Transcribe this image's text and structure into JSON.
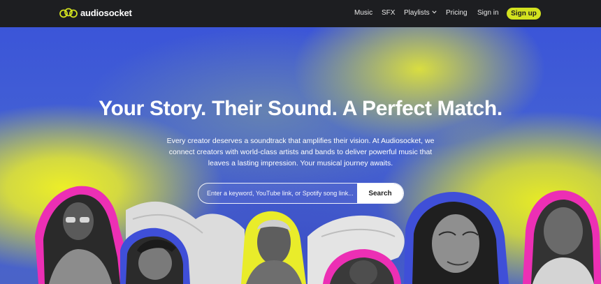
{
  "brand": {
    "name": "audiosocket"
  },
  "nav": {
    "items": [
      {
        "label": "Music"
      },
      {
        "label": "SFX"
      },
      {
        "label": "Playlists"
      },
      {
        "label": "Pricing"
      },
      {
        "label": "Sign in"
      }
    ],
    "signup_label": "Sign up"
  },
  "hero": {
    "title": "Your Story. Their Sound. A Perfect Match.",
    "subtitle": "Every creator deserves a soundtrack that amplifies their vision. At Audiosocket, we connect creators with world-class artists and bands to deliver powerful music that leaves a lasting impression. Your musical journey awaits.",
    "search": {
      "placeholder": "Enter a keyword, YouTube link, or Spotify song link...",
      "value": "",
      "button_label": "Search"
    }
  },
  "colors": {
    "navbar_bg": "#1d1e21",
    "accent_lime": "#d3e21f",
    "hero_blue": "#3b55d8",
    "hero_yellow": "#ecee28",
    "sticker_pink": "#ec2fb4",
    "sticker_blue": "#3f4fd8"
  },
  "icons": {
    "logo": "audiosocket-logo-icon",
    "playlists_dropdown": "chevron-down-icon"
  }
}
